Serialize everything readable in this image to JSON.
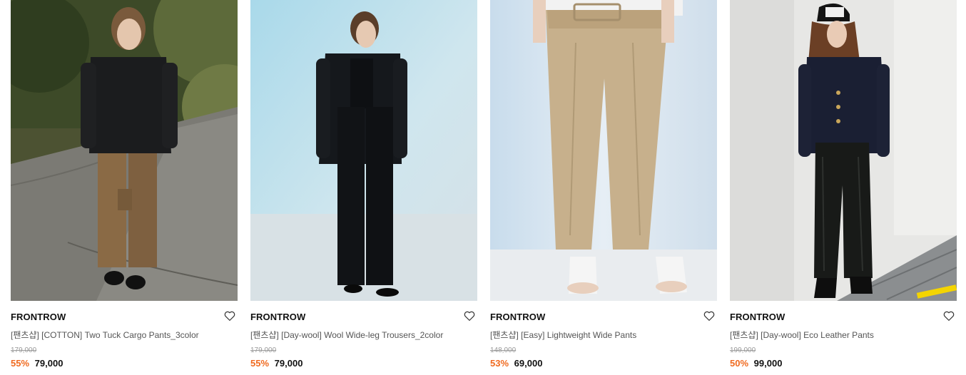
{
  "products": [
    {
      "brand": "FRONTROW",
      "name": "[팬츠샵] [COTTON] Two Tuck Cargo Pants_3color",
      "original_price": "179,000",
      "discount": "55%",
      "price": "79,000",
      "image_icon": "product-photo-cargo-pants"
    },
    {
      "brand": "FRONTROW",
      "name": "[팬츠샵] [Day-wool] Wool Wide-leg Trousers_2color",
      "original_price": "179,000",
      "discount": "55%",
      "price": "79,000",
      "image_icon": "product-photo-wool-trousers"
    },
    {
      "brand": "FRONTROW",
      "name": "[팬츠샵] [Easy] Lightweight Wide Pants",
      "original_price": "148,000",
      "discount": "53%",
      "price": "69,000",
      "image_icon": "product-photo-wide-pants"
    },
    {
      "brand": "FRONTROW",
      "name": "[팬츠샵] [Day-wool] Eco Leather Pants",
      "original_price": "199,000",
      "discount": "50%",
      "price": "99,000",
      "image_icon": "product-photo-leather-pants"
    }
  ],
  "colors": {
    "discount": "#f06a1f",
    "brand": "#111111",
    "name": "#555555",
    "original_price": "#9a9a9a"
  },
  "icons": {
    "wishlist": "heart-outline-icon"
  }
}
